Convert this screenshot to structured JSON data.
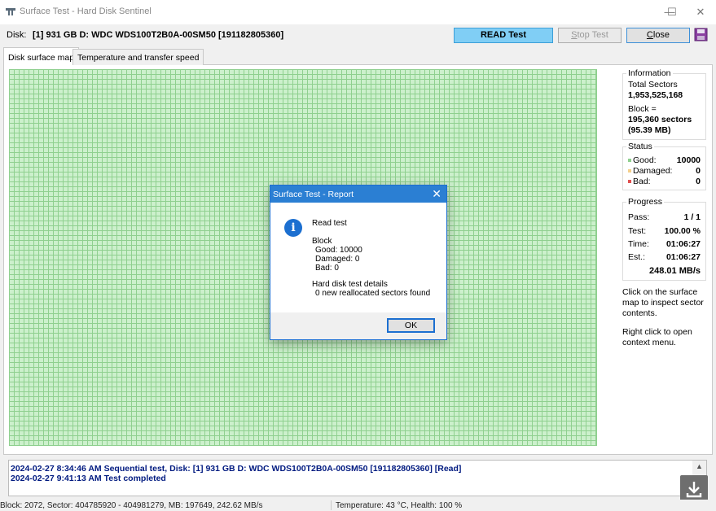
{
  "window": {
    "title": "Surface Test - Hard Disk Sentinel",
    "minimize": "—",
    "maximize": "☐",
    "close": "✕"
  },
  "disk": {
    "label": "Disk:",
    "value": "[1] 931 GB D: WDC  WDS100T2B0A-00SM50 [191182805360]"
  },
  "toolbar": {
    "read_test": "READ Test",
    "stop_test_pre": "S",
    "stop_test_rest": "top Test",
    "close_pre": "C",
    "close_rest": "lose"
  },
  "tabs": [
    {
      "label": "Disk surface map",
      "active": true
    },
    {
      "label": "Temperature and transfer speed",
      "active": false
    }
  ],
  "information": {
    "title": "Information",
    "total_sectors_label": "Total Sectors",
    "total_sectors_value": "1,953,525,168",
    "block_label": "Block =",
    "block_sectors": "195,360 sectors",
    "block_size": "(95.39 MB)"
  },
  "status": {
    "title": "Status",
    "rows": [
      {
        "label": "Good:",
        "value": "10000",
        "color": "#8fd08f"
      },
      {
        "label": "Damaged:",
        "value": "0",
        "color": "#f5d08c"
      },
      {
        "label": "Bad:",
        "value": "0",
        "color": "#e05050"
      }
    ]
  },
  "progress": {
    "title": "Progress",
    "rows": [
      {
        "label": "Pass:",
        "value": "1 / 1"
      },
      {
        "label": "Test:",
        "value": "100.00 %"
      },
      {
        "label": "Time:",
        "value": "01:06:27"
      },
      {
        "label": "Est.:",
        "value": "01:06:27"
      }
    ],
    "speed": "248.01 MB/s"
  },
  "hints": {
    "inspect_1": "Click on the surface",
    "inspect_2": "map to inspect sector",
    "inspect_3": "contents.",
    "context_1": "Right click to open",
    "context_2": "context menu."
  },
  "log": [
    "2024-02-27  8:34:46 AM   Sequential test, Disk: [1] 931 GB D: WDC  WDS100T2B0A-00SM50 [191182805360] [Read]",
    "2024-02-27  9:41:13 AM   Test completed"
  ],
  "statusbar": {
    "left": "Block: 2072, Sector: 404785920 - 404981279, MB: 197649, 242.62 MB/s",
    "right": "Temperature: 43  °C,  Health: 100 %"
  },
  "dialog": {
    "title": "Surface Test - Report",
    "close": "✕",
    "icon": "i",
    "heading": "Read test",
    "block_label": "Block",
    "good": "Good: 10000",
    "damaged": "Damaged: 0",
    "bad": "Bad: 0",
    "details_label": "Hard disk test details",
    "details_value": "0 new reallocated sectors found",
    "ok": "OK"
  },
  "colors": {
    "map_fill": "#ccf0cc",
    "map_grid": "#8fd08f",
    "accent": "#2b7fd3",
    "read_button": "#80cef5",
    "log_text": "#001a80"
  }
}
